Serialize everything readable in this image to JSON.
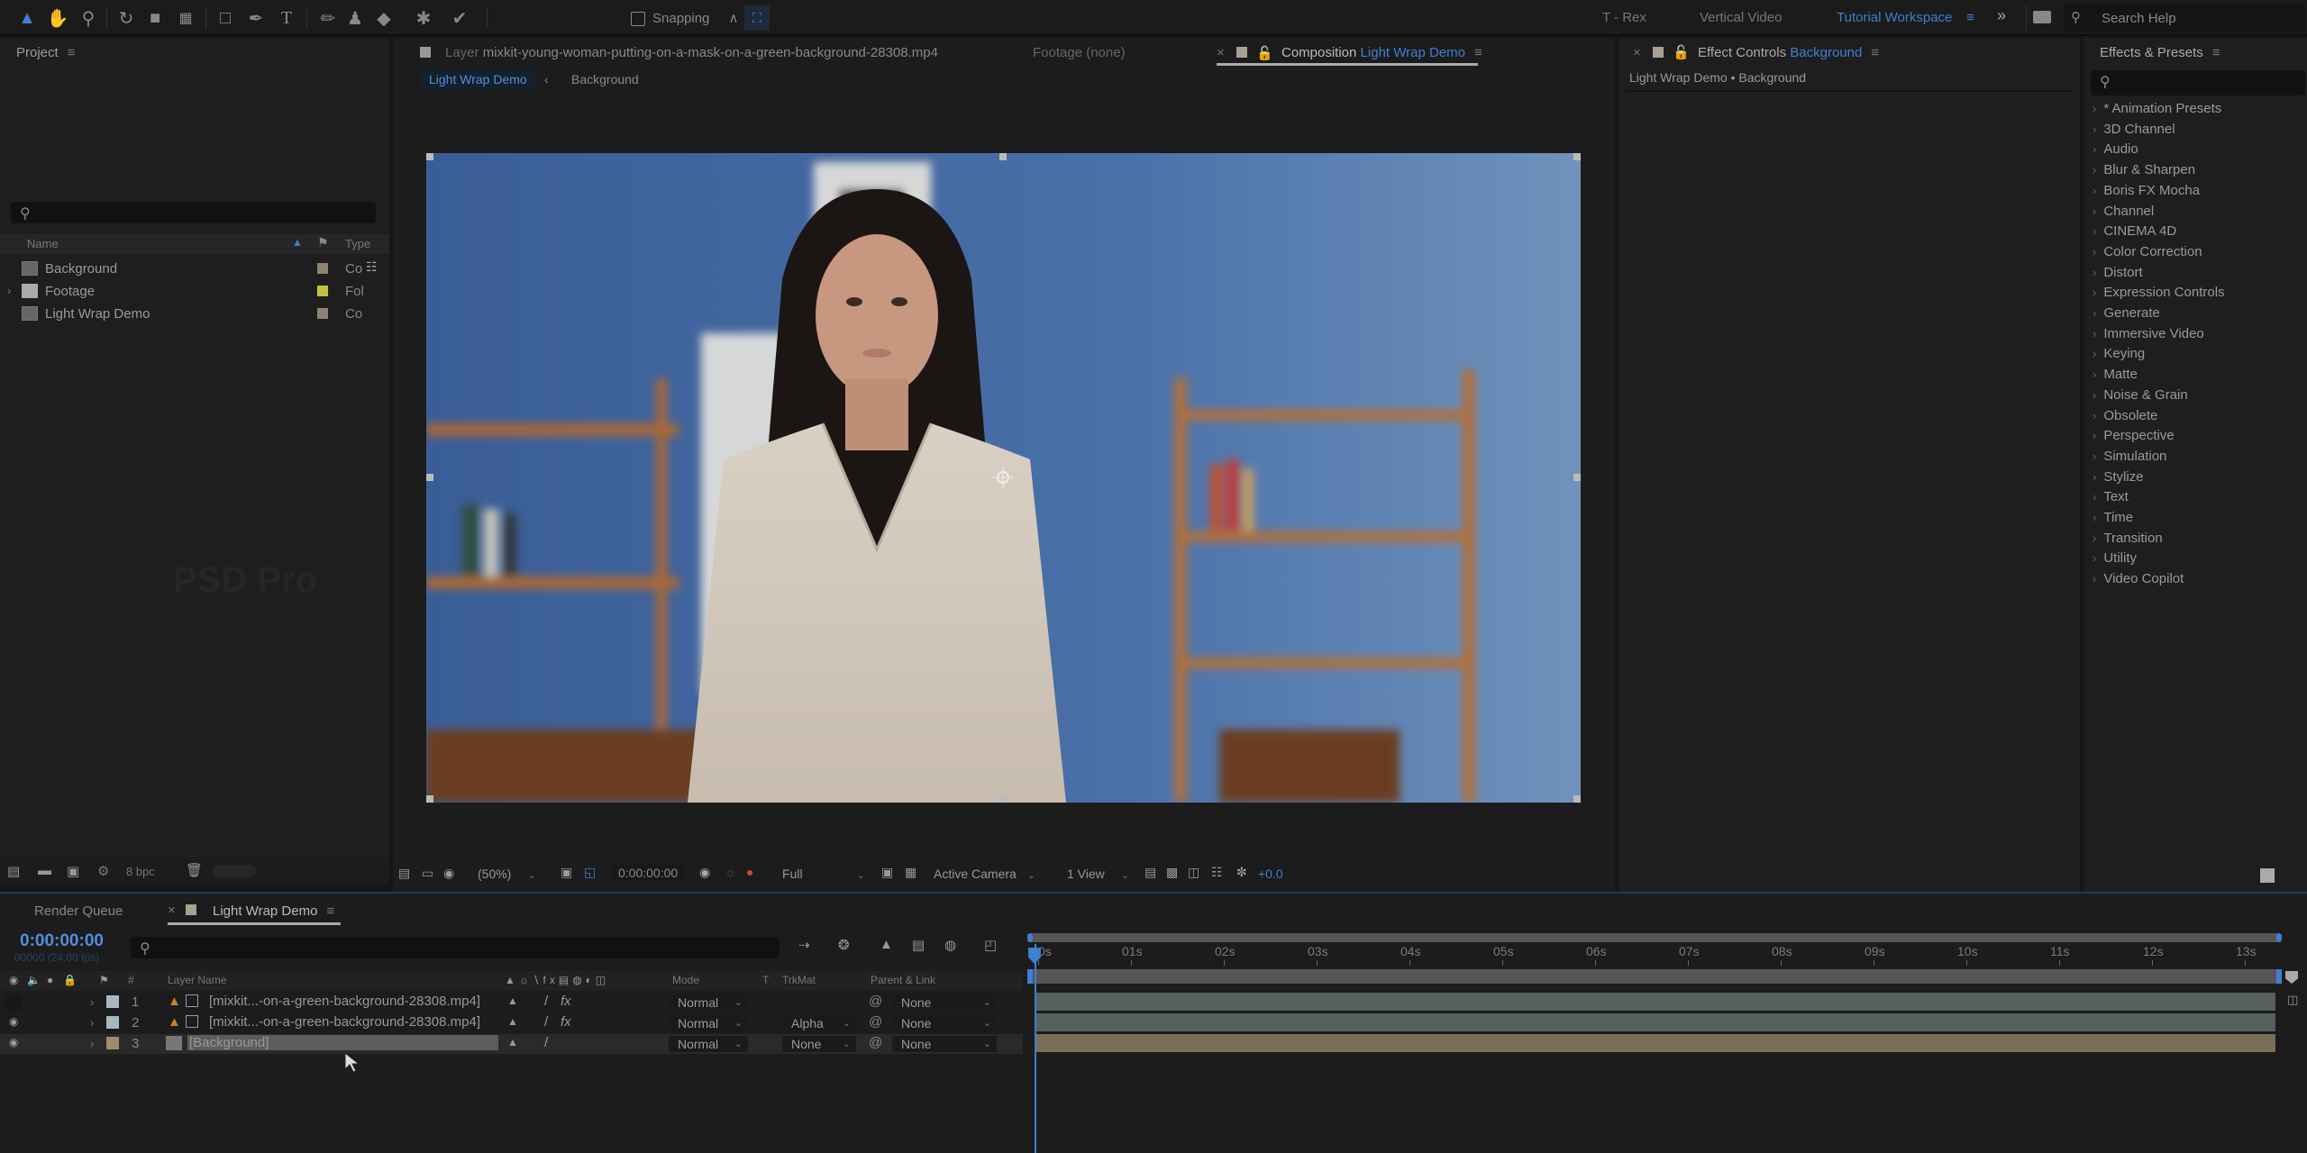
{
  "toolbar": {
    "tools": [
      "selection-tool",
      "hand-tool",
      "zoom-tool",
      "rotate-tool",
      "camera-tool",
      "pan-behind-tool",
      "rectangle-tool",
      "pen-tool",
      "type-tool",
      "brush-tool",
      "clone-stamp-tool",
      "eraser-tool",
      "roto-brush-tool",
      "puppet-pin-tool"
    ],
    "snapping_label": "Snapping",
    "workspaces": [
      "T - Rex",
      "Vertical Video",
      "Tutorial Workspace"
    ],
    "active_workspace": "Tutorial Workspace",
    "search_placeholder": "Search Help",
    "overflow": "»"
  },
  "project": {
    "title": "Project",
    "search_placeholder": "",
    "columns": {
      "name": "Name",
      "type": "Type"
    },
    "items": [
      {
        "name": "Background",
        "type": "Co",
        "label_color": "#8c8470",
        "kind": "composition",
        "expandable": false
      },
      {
        "name": "Footage",
        "type": "Fol",
        "label_color": "#c8c040",
        "kind": "folder",
        "expandable": true
      },
      {
        "name": "Light Wrap Demo",
        "type": "Co",
        "label_color": "#8c8470",
        "kind": "composition",
        "expandable": false
      }
    ],
    "watermark": "PSD Pro",
    "footer": {
      "bpc": "8 bpc"
    }
  },
  "viewer": {
    "tabs": [
      {
        "prefix": "Layer",
        "name": "mixkit-young-woman-putting-on-a-mask-on-a-green-background-28308.mp4"
      },
      {
        "prefix": "Footage",
        "name": "(none)"
      },
      {
        "prefix": "Composition",
        "name": "Light Wrap Demo",
        "active": true
      }
    ],
    "breadcrumb": [
      "Light Wrap Demo",
      "Background"
    ],
    "footer": {
      "zoom": "(50%)",
      "timecode": "0:00:00:00",
      "resolution": "Full",
      "camera": "Active Camera",
      "views": "1 View",
      "exposure": "+0.0"
    }
  },
  "effect_controls": {
    "title": "Effect Controls",
    "layer": "Background",
    "subtitle": "Light Wrap Demo • Background"
  },
  "effects_presets": {
    "title": "Effects & Presets",
    "search_placeholder": "",
    "items": [
      "* Animation Presets",
      "3D Channel",
      "Audio",
      "Blur & Sharpen",
      "Boris FX Mocha",
      "Channel",
      "CINEMA 4D",
      "Color Correction",
      "Distort",
      "Expression Controls",
      "Generate",
      "Immersive Video",
      "Keying",
      "Matte",
      "Noise & Grain",
      "Obsolete",
      "Perspective",
      "Simulation",
      "Stylize",
      "Text",
      "Time",
      "Transition",
      "Utility",
      "Video Copilot"
    ]
  },
  "timeline": {
    "tabs": [
      {
        "label": "Render Queue"
      },
      {
        "label": "Light Wrap Demo",
        "active": true
      }
    ],
    "timecode": "0:00:00:00",
    "frame_info": "00000 (24.00 fps)",
    "columns": {
      "layer_name": "Layer Name",
      "mode": "Mode",
      "t": "T",
      "trkmat": "TrkMat",
      "parent": "Parent & Link"
    },
    "layers": [
      {
        "num": "1",
        "name": "[mixkit...-on-a-green-background-28308.mp4]",
        "label_color": "#a8b8c0",
        "mode": "Normal",
        "trkmat": "",
        "parent": "None",
        "visible": false,
        "fx": true,
        "selected": false
      },
      {
        "num": "2",
        "name": "[mixkit...-on-a-green-background-28308.mp4]",
        "label_color": "#a8b8c0",
        "mode": "Normal",
        "trkmat": "Alpha",
        "parent": "None",
        "visible": true,
        "fx": true,
        "selected": false
      },
      {
        "num": "3",
        "name": "[Background]",
        "label_color": "#9c8e6c",
        "mode": "Normal",
        "trkmat": "None",
        "parent": "None",
        "visible": true,
        "fx": false,
        "selected": true
      }
    ],
    "ruler": [
      "0s",
      "01s",
      "02s",
      "03s",
      "04s",
      "05s",
      "06s",
      "07s",
      "08s",
      "09s",
      "10s",
      "11s",
      "12s",
      "13s"
    ],
    "colors": {
      "footage_bar": "#56605f",
      "comp_bar": "#7a6e58",
      "playhead": "#3f7fd1"
    }
  }
}
